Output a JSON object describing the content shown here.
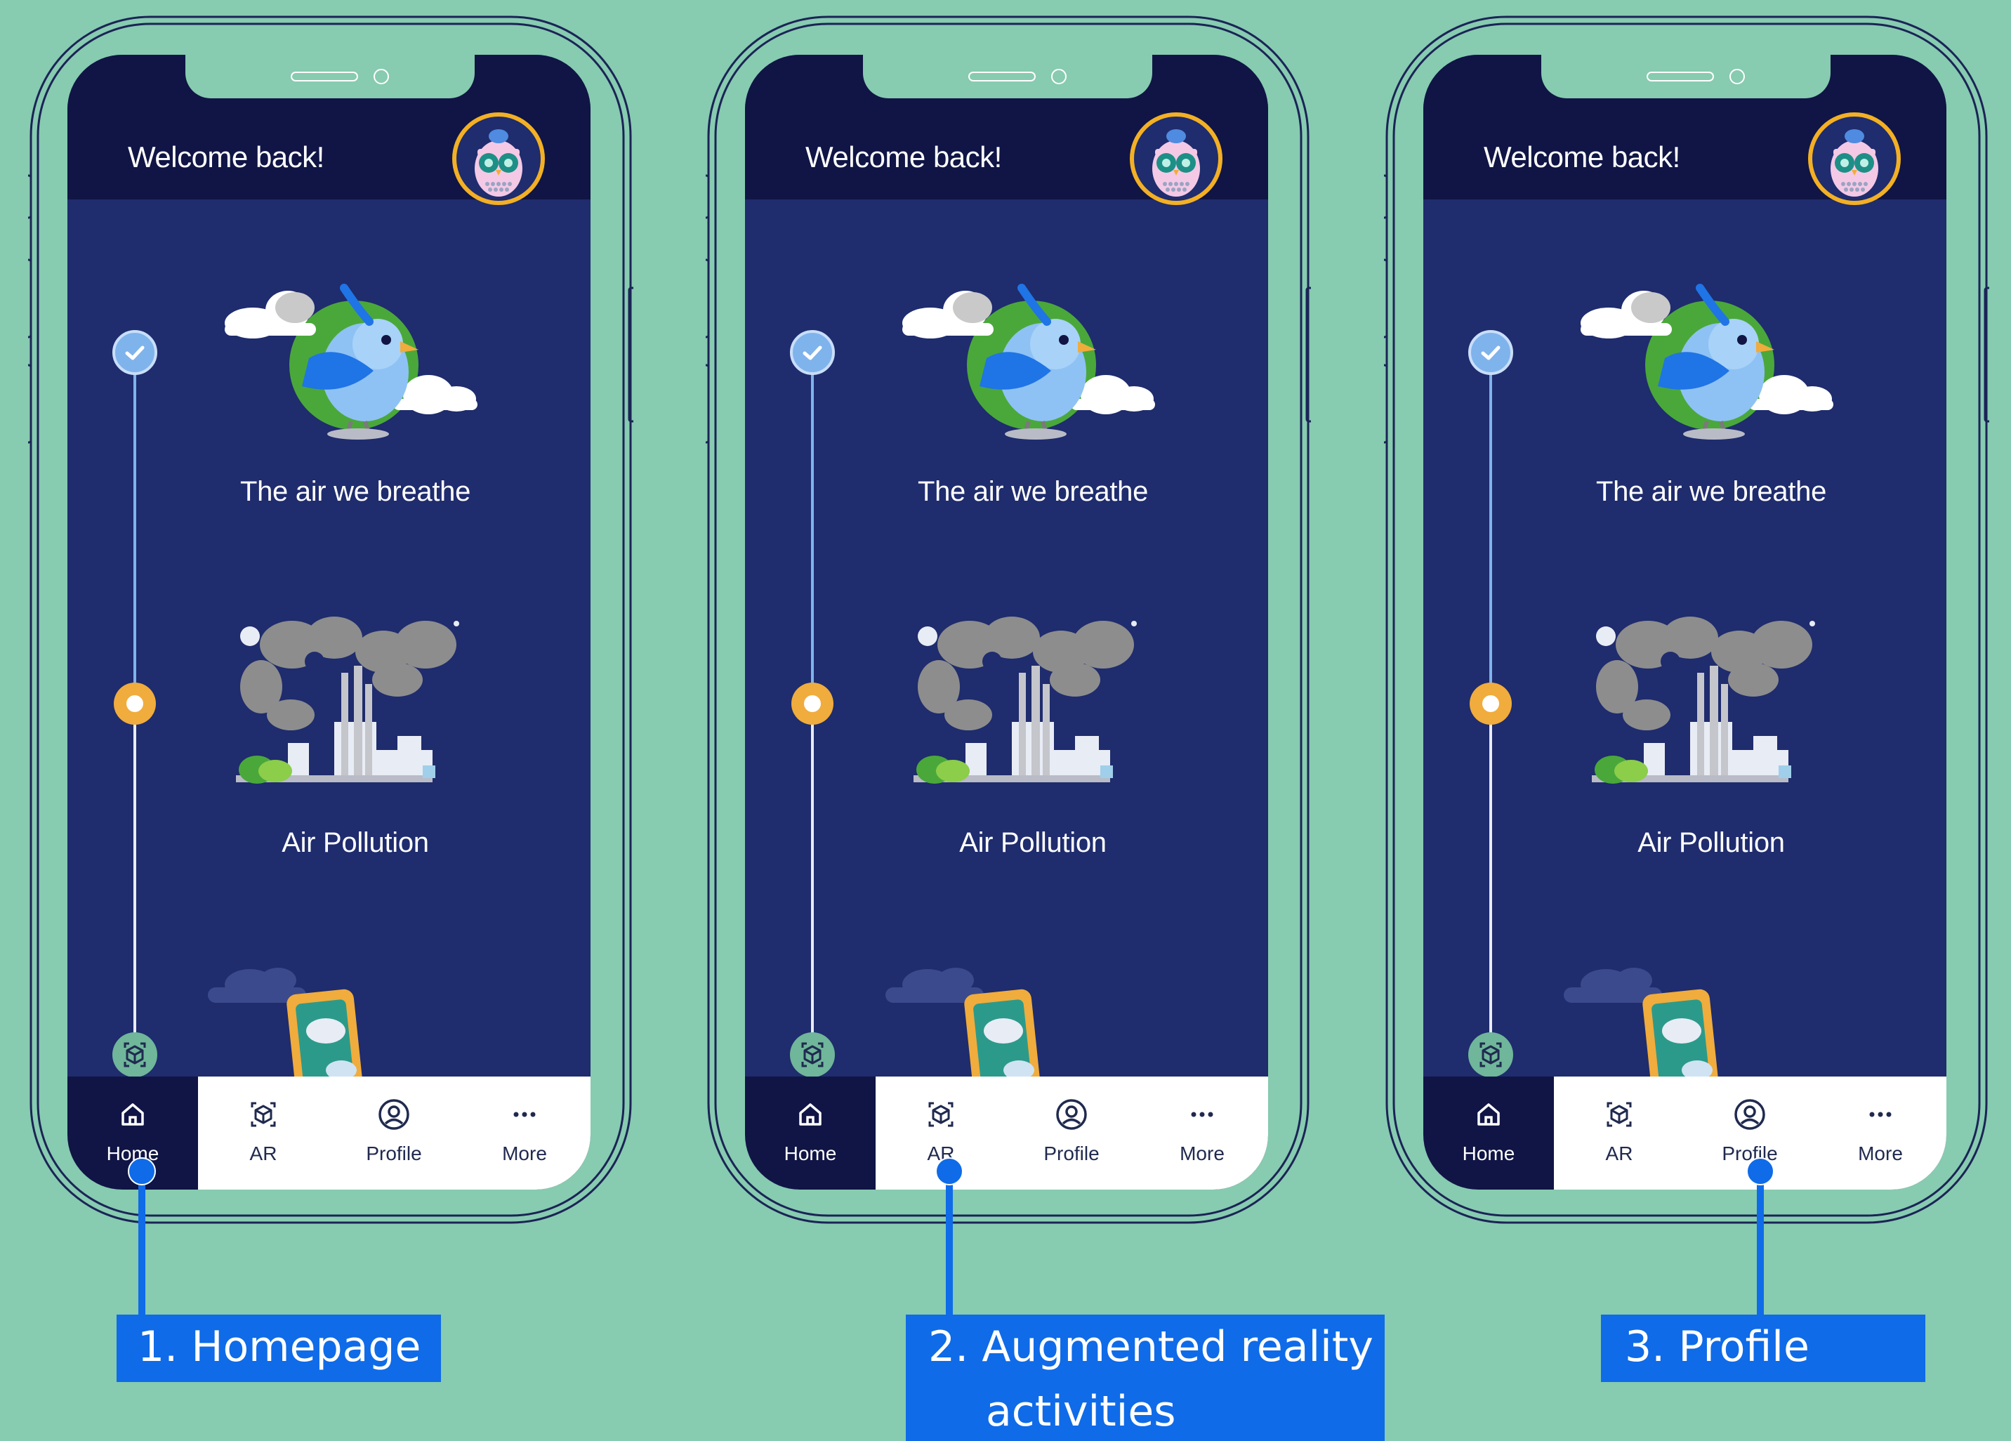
{
  "phones": [
    {
      "header": {
        "welcome": "Welcome back!"
      },
      "lessons": [
        {
          "title": "The air we breathe",
          "status": "completed"
        },
        {
          "title": "Air Pollution",
          "status": "current"
        },
        {
          "title": "",
          "status": "ar"
        }
      ],
      "nav": {
        "items": [
          "Home",
          "AR",
          "Profile",
          "More"
        ],
        "active": "Home"
      },
      "callout": {
        "number": "1.",
        "text": "Homepage",
        "pointer_target": "Home"
      }
    },
    {
      "header": {
        "welcome": "Welcome back!"
      },
      "lessons": [
        {
          "title": "The air we breathe",
          "status": "completed"
        },
        {
          "title": "Air Pollution",
          "status": "current"
        },
        {
          "title": "",
          "status": "ar"
        }
      ],
      "nav": {
        "items": [
          "Home",
          "AR",
          "Profile",
          "More"
        ],
        "active": "Home"
      },
      "callout": {
        "number": "2.",
        "text": "Augmented reality",
        "text2": "activities",
        "pointer_target": "AR"
      }
    },
    {
      "header": {
        "welcome": "Welcome back!"
      },
      "lessons": [
        {
          "title": "The air we breathe",
          "status": "completed"
        },
        {
          "title": "Air Pollution",
          "status": "current"
        },
        {
          "title": "",
          "status": "ar"
        }
      ],
      "nav": {
        "items": [
          "Home",
          "AR",
          "Profile",
          "More"
        ],
        "active": "Home"
      },
      "callout": {
        "number": "3.",
        "text": "Profile",
        "pointer_target": "Profile"
      }
    }
  ],
  "icons": {
    "home": "home-icon",
    "ar": "ar-cube-icon",
    "profile": "profile-circle-icon",
    "more": "more-dots-icon",
    "check": "check-icon",
    "avatar": "owl-avatar-icon"
  },
  "colors": {
    "background": "#87cbb0",
    "header": "#101545",
    "screen": "#1f2c6d",
    "accent_blue": "#0f6be8",
    "avatar_ring": "#f3b024",
    "current_node": "#f0ac3c",
    "completed_node": "#7fb3ec"
  }
}
